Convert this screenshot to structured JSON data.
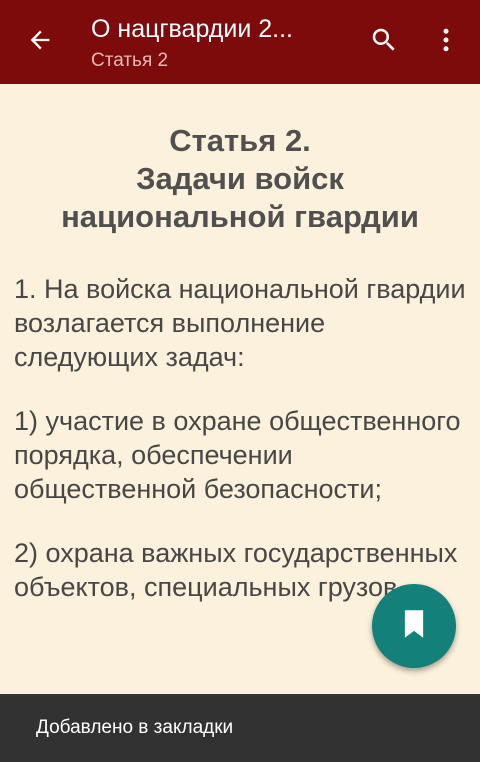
{
  "appbar": {
    "title": "О нацгвардии 2...",
    "subtitle": "Статья 2",
    "back_icon": "arrow-left-icon",
    "search_icon": "search-icon",
    "more_icon": "more-vert-icon",
    "background_color": "#7e0b0b"
  },
  "article": {
    "heading_lines": [
      "Статья 2.",
      "Задачи войск",
      "национальной гвардии"
    ],
    "paragraphs": [
      "1. На войска национальной гвардии возлагается выполнение следующих задач:",
      "1) участие в охране общественного порядка, обеспечении общественной безопасности;",
      "2) охрана важных государственных объектов, специальных грузов,"
    ],
    "background_color": "#fbf1dc"
  },
  "fab": {
    "icon": "bookmark-icon",
    "color": "#13807a"
  },
  "snackbar": {
    "message": "Добавлено в закладки"
  }
}
